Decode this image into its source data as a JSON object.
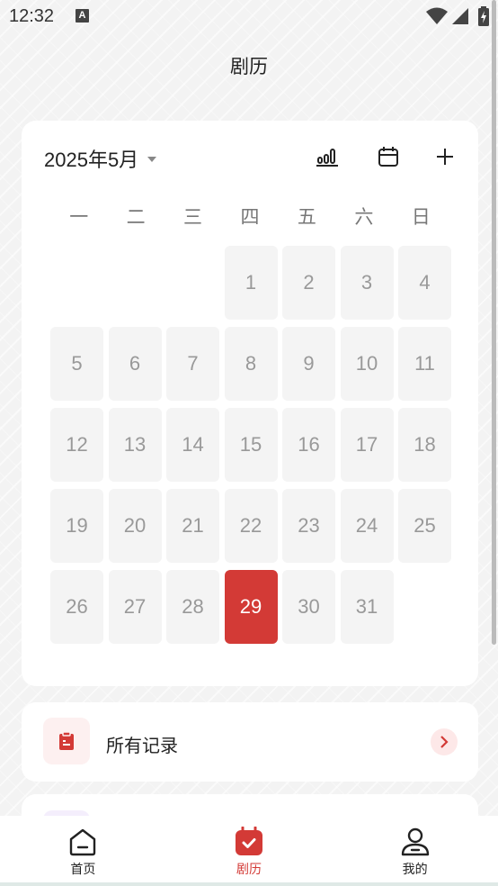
{
  "status_bar": {
    "time": "12:32",
    "a_icon_text": "A",
    "icons": [
      "a-icon",
      "wifi-icon",
      "signal-icon",
      "battery-icon"
    ]
  },
  "header": {
    "title": "剧历"
  },
  "calendar": {
    "month_label": "2025年5月",
    "tools": [
      "stats-icon",
      "calendar-icon",
      "plus-icon"
    ],
    "weekdays": [
      "一",
      "二",
      "三",
      "四",
      "五",
      "六",
      "日"
    ],
    "start_weekday_index": 3,
    "days_in_month": 31,
    "selected_day": 29,
    "selected_color": "#d33a36"
  },
  "records": {
    "label": "所有记录",
    "accent": "#d33a36"
  },
  "bottom_nav": {
    "items": [
      {
        "label": "首页",
        "icon": "home-icon",
        "active": false
      },
      {
        "label": "剧历",
        "icon": "calendar-check-icon",
        "active": true
      },
      {
        "label": "我的",
        "icon": "profile-icon",
        "active": false
      }
    ],
    "active_color": "#d33a36"
  }
}
